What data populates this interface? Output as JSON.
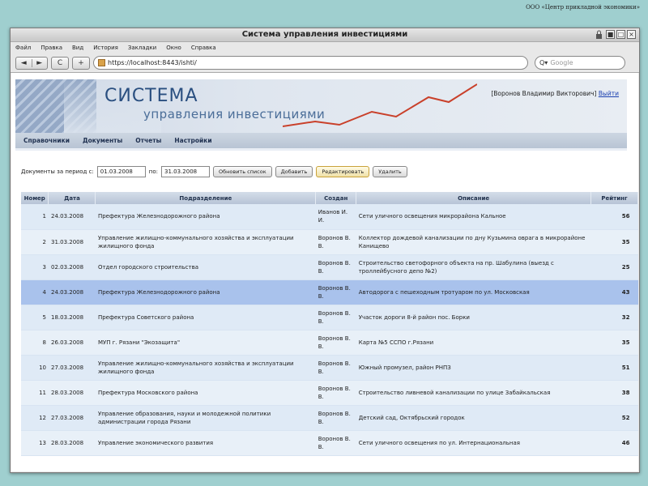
{
  "company": "ООО «Центр прикладной экономики»",
  "window": {
    "title": "Система управления инвестициями",
    "buttons": [
      "■",
      "□",
      "×"
    ]
  },
  "menu": [
    "Файл",
    "Правка",
    "Вид",
    "История",
    "Закладки",
    "Окно",
    "Справка"
  ],
  "nav": {
    "back": "◄",
    "forward": "►",
    "reload": "C",
    "add": "+",
    "url": "https://localhost:8443/ishti/",
    "search_placeholder": "Google"
  },
  "banner": {
    "title_line1": "СИСТЕМА",
    "title_line2": "управления инвестициями",
    "user": "[Воронов Владимир Викторович]",
    "logout": "Выйти"
  },
  "appmenu": [
    "Справочники",
    "Документы",
    "Отчеты",
    "Настройки"
  ],
  "toolbar": {
    "period_label": "Документы за период с:",
    "from": "01.03.2008",
    "to_label": "по:",
    "to": "31.03.2008",
    "refresh": "Обновить список",
    "add": "Добавить",
    "edit": "Редактировать",
    "delete": "Удалить"
  },
  "table": {
    "headers": [
      "Номер",
      "Дата",
      "Подразделение",
      "Создан",
      "Описание",
      "Рейтинг"
    ],
    "rows": [
      {
        "num": "1",
        "date": "24.03.2008",
        "dept": "Префектура Железнодорожного района",
        "author": "Иванов И. И.",
        "desc": "Сети уличного освещения микрорайона Кальное",
        "rating": "56"
      },
      {
        "num": "2",
        "date": "31.03.2008",
        "dept": "Управление жилищно-коммунального хозяйства и эксплуатации жилищного фонда",
        "author": "Воронов В. В.",
        "desc": "Коллектор дождевой канализации по дну Кузьмина оврага в микрорайоне Канищево",
        "rating": "35"
      },
      {
        "num": "3",
        "date": "02.03.2008",
        "dept": "Отдел городского строительства",
        "author": "Воронов В. В.",
        "desc": "Строительство светофорного объекта на пр. Шабулина (выезд с троллейбусного депо №2)",
        "rating": "25"
      },
      {
        "num": "4",
        "date": "24.03.2008",
        "dept": "Префектура Железнодорожного района",
        "author": "Воронов В. В.",
        "desc": "Автодорога с пешеходным тротуаром по ул. Московская",
        "rating": "43"
      },
      {
        "num": "5",
        "date": "18.03.2008",
        "dept": "Префектура Советского района",
        "author": "Воронов В. В.",
        "desc": "Участок дороги 8-й район пос. Борки",
        "rating": "32"
      },
      {
        "num": "8",
        "date": "26.03.2008",
        "dept": "МУП г. Рязани \"Экозащита\"",
        "author": "Воронов В. В.",
        "desc": "Карта №5 ССПО г.Рязани",
        "rating": "35"
      },
      {
        "num": "10",
        "date": "27.03.2008",
        "dept": "Управление жилищно-коммунального хозяйства и эксплуатации жилищного фонда",
        "author": "Воронов В. В.",
        "desc": "Южный промузел, район РНПЗ",
        "rating": "51"
      },
      {
        "num": "11",
        "date": "28.03.2008",
        "dept": "Префектура Московского района",
        "author": "Воронов В. В.",
        "desc": "Строительство ливневой канализации по улице Забайкальская",
        "rating": "38"
      },
      {
        "num": "12",
        "date": "27.03.2008",
        "dept": "Управление образования, науки и молодежной политики администрации города Рязани",
        "author": "Воронов В. В.",
        "desc": "Детский сад, Октябрьский городок",
        "rating": "52"
      },
      {
        "num": "13",
        "date": "28.03.2008",
        "dept": "Управление экономического развития",
        "author": "Воронов В. В.",
        "desc": "Сети уличного освещения по ул. Интернациональная",
        "rating": "46"
      }
    ],
    "selected_num": "4"
  }
}
